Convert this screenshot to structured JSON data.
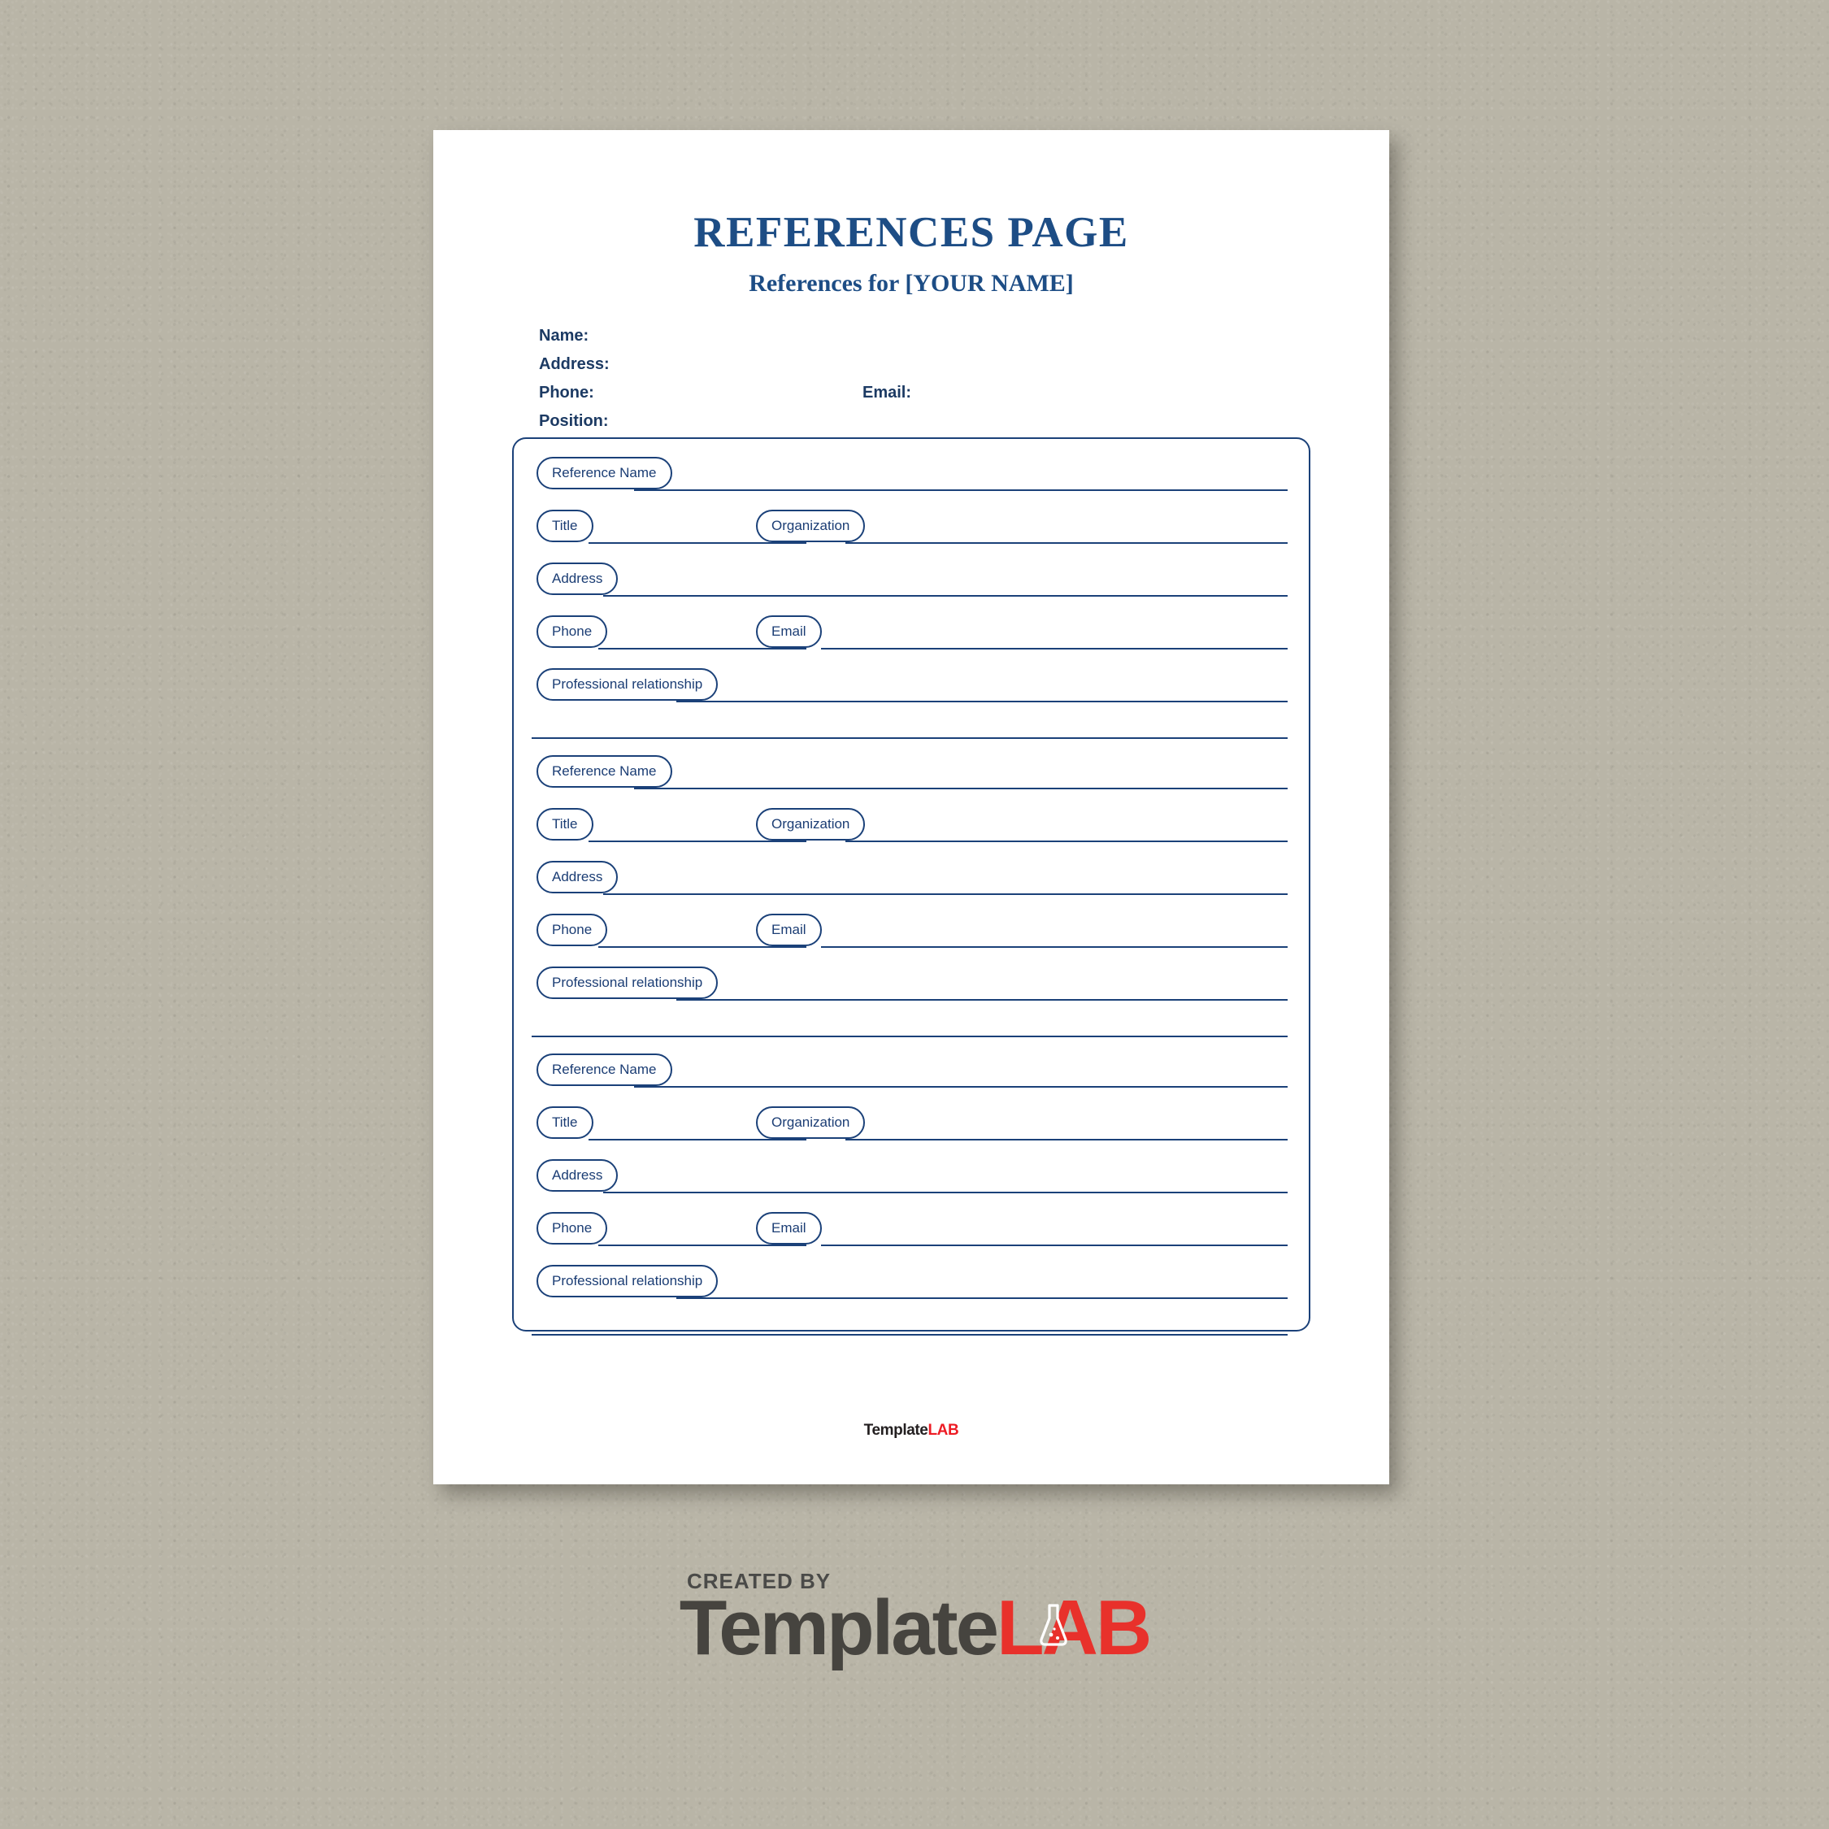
{
  "document": {
    "title": "REFERENCES PAGE",
    "subtitle": "References for [YOUR NAME]"
  },
  "applicant": {
    "name_label": "Name:",
    "address_label": "Address:",
    "phone_label": "Phone:",
    "email_label": "Email:",
    "position_label": "Position:"
  },
  "field_labels": {
    "reference_name": "Reference Name",
    "title": "Title",
    "organization": "Organization",
    "address": "Address",
    "phone": "Phone",
    "email": "Email",
    "professional_relationship": "Professional relationship"
  },
  "references": [
    {
      "reference_name": "",
      "title": "",
      "organization": "",
      "address": "",
      "phone": "",
      "email": "",
      "professional_relationship": "",
      "professional_relationship_cont": ""
    },
    {
      "reference_name": "",
      "title": "",
      "organization": "",
      "address": "",
      "phone": "",
      "email": "",
      "professional_relationship": "",
      "professional_relationship_cont": ""
    },
    {
      "reference_name": "",
      "title": "",
      "organization": "",
      "address": "",
      "phone": "",
      "email": "",
      "professional_relationship": "",
      "professional_relationship_cont": ""
    }
  ],
  "page_footer": {
    "brand_first": "Template",
    "brand_second": "LAB"
  },
  "watermark": {
    "created_by": "CREATED BY",
    "brand_first": "Template",
    "brand_second_left": "L",
    "brand_second_mid": "A",
    "brand_second_right": "B",
    "flask_icon": "flask-icon"
  },
  "colors": {
    "accent_blue": "#1d4d85",
    "line_blue": "#1b4179",
    "label_navy": "#1c3a63",
    "brand_red": "#ed1c24",
    "brand_dark": "#231f20",
    "desk": "#b9b5a7",
    "paper": "#ffffff"
  }
}
